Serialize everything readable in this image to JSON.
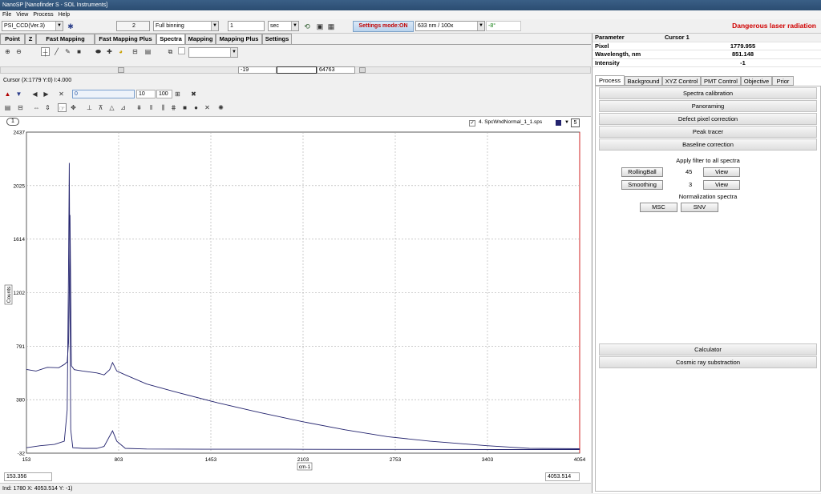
{
  "window": {
    "title": "NanoSP [Nanofinder S - SOL Instruments]"
  },
  "menu": [
    "File",
    "View",
    "Process",
    "Help"
  ],
  "toolbar": {
    "device": "PSI_CCD(Ver.3)",
    "accumulations": "2",
    "binning": "Full binning",
    "exposure": "1",
    "exposure_unit": "sec",
    "settings_mode": "Settings mode:ON",
    "laser": "633 nm / 100x",
    "temperature": "-8°",
    "warning": "Dangerous laser radiation"
  },
  "tabs": [
    "Point",
    "Z",
    "Fast Mapping",
    "Fast Mapping Plus",
    "Spectra",
    "Mapping",
    "Mapping Plus",
    "Settings"
  ],
  "active_tab": "Spectra",
  "spectra_toolbar": {
    "combo_value": ""
  },
  "range_bar": {
    "min": "-19",
    "max": "64763"
  },
  "cursor_text": "Cursor (X:1779 Y:0) I:4.000",
  "nav": {
    "field1": "0",
    "field2": "10",
    "field3": "100"
  },
  "plot": {
    "tab_number": "1",
    "legend_file": "4. SpcWndNormal_1_1.sps",
    "legend_count": "5",
    "series_color": "#23236e",
    "x_left_value": "153.356",
    "x_right_value": "4053.514"
  },
  "chart_data": {
    "type": "line",
    "xlabel": "cm-1",
    "ylabel": "Counts",
    "xlim": [
      153,
      4054
    ],
    "ylim": [
      -32,
      2437
    ],
    "xticks": [
      "153",
      "803",
      "1453",
      "2103",
      "2753",
      "3403",
      "4054"
    ],
    "yticks": [
      "2437",
      "2025",
      "1614",
      "1202",
      "791",
      "380",
      "-32"
    ],
    "series": [
      {
        "x": [
          153,
          220,
          300,
          380,
          420,
          440,
          450,
          455,
          460,
          470,
          490,
          550,
          650,
          700,
          740,
          760,
          790,
          850,
          1000,
          1200,
          1500,
          1800,
          2100,
          2400,
          2700,
          3000,
          3400,
          3700,
          4054
        ],
        "y": [
          612,
          600,
          628,
          625,
          650,
          670,
          820,
          1200,
          1800,
          640,
          610,
          600,
          585,
          570,
          610,
          665,
          600,
          570,
          500,
          440,
          355,
          280,
          210,
          148,
          95,
          60,
          25,
          5,
          2
        ]
      },
      {
        "x": [
          153,
          250,
          350,
          420,
          440,
          450,
          455,
          460,
          465,
          480,
          550,
          650,
          700,
          740,
          760,
          790,
          850,
          1000,
          1500,
          2000,
          2500,
          3000,
          3500,
          4054
        ],
        "y": [
          10,
          25,
          35,
          60,
          300,
          1400,
          2200,
          1100,
          150,
          10,
          5,
          5,
          20,
          100,
          140,
          60,
          5,
          0,
          -2,
          -2,
          -3,
          -3,
          -4,
          -4
        ]
      }
    ]
  },
  "statusbar": "Ind: 1780 X: 4053.514 Y: -1)",
  "right": {
    "table": [
      {
        "key": "Parameter",
        "value": "Cursor 1"
      },
      {
        "key": "Pixel",
        "value": "1779.955"
      },
      {
        "key": "Wavelength, nm",
        "value": "851.148"
      },
      {
        "key": "Intensity",
        "value": "-1"
      }
    ],
    "tabs": [
      "Process",
      "Background",
      "XYZ Control",
      "PMT Control",
      "Objective",
      "Prior"
    ],
    "sections": [
      "Spectra calibration",
      "Panoraming",
      "Defect pixel correction",
      "Peak tracer",
      "Baseline correction"
    ],
    "apply_label": "Apply filter to all spectra",
    "rolling_label": "RollingBall",
    "rolling_value": "45",
    "smoothing_label": "Smoothing",
    "smoothing_value": "3",
    "view_label": "View",
    "normalization_label": "Normalization spectra",
    "msc_label": "MSC",
    "snv_label": "SNV",
    "bottom_sections": [
      "Calculator",
      "Cosmic ray substraction"
    ]
  }
}
